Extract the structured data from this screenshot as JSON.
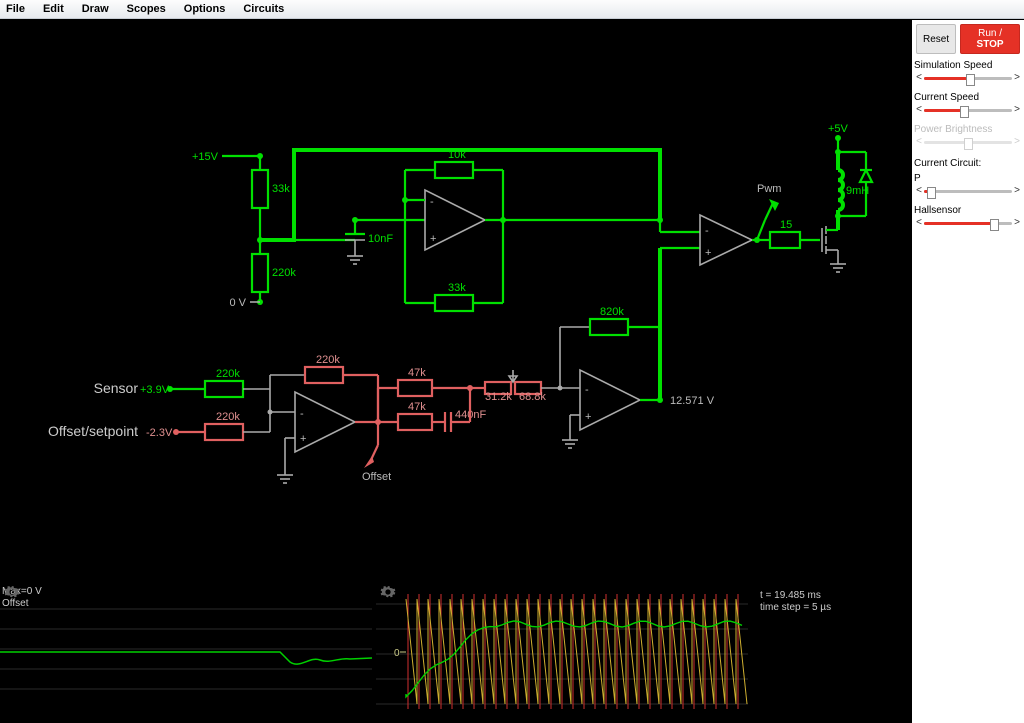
{
  "menu": {
    "file": "File",
    "edit": "Edit",
    "draw": "Draw",
    "scopes": "Scopes",
    "options": "Options",
    "circuits": "Circuits"
  },
  "buttons": {
    "reset": "Reset",
    "run": "Run / ",
    "stop": "STOP"
  },
  "sliders": {
    "sim": {
      "label": "Simulation Speed",
      "percent": 52
    },
    "cur": {
      "label": "Current Speed",
      "percent": 45
    },
    "power": {
      "label": "Power Brightness",
      "percent": 50,
      "disabled": true
    },
    "p": {
      "label": "P",
      "percent": 8
    },
    "hall": {
      "label": "Hallsensor",
      "percent": 80
    }
  },
  "currentCircuit": "Current Circuit:",
  "scopeInfo": {
    "t": "t = 19.485 ms",
    "step": "time step = 5 µs"
  },
  "scope1": {
    "max": "Max=0 V",
    "name": "Offset"
  },
  "scope2": {
    "zero": "0"
  },
  "circuit": {
    "sensor_label": "Sensor",
    "sensor_v": "+3.9V",
    "offset_label": "Offset/setpoint",
    "offset_v": "-2.3V",
    "plus15": "+15V",
    "zeroV": "0 V",
    "plus5": "+5V",
    "r33k": "33k",
    "r220k": "220k",
    "r10k": "10k",
    "r33k_b": "33k",
    "c10n": "10nF",
    "r220k_s": "220k",
    "r220k_o": "220k",
    "r220k_fb": "220k",
    "r47k_a": "47k",
    "r47k_b": "47k",
    "c440n": "440nF",
    "r312": "31.2k",
    "r688": "68.8k",
    "r820k": "820k",
    "offset_arrow": "Offset",
    "vout": "12.571 V",
    "pwm": "Pwm",
    "r15": "15",
    "l9mh": "9mH"
  }
}
